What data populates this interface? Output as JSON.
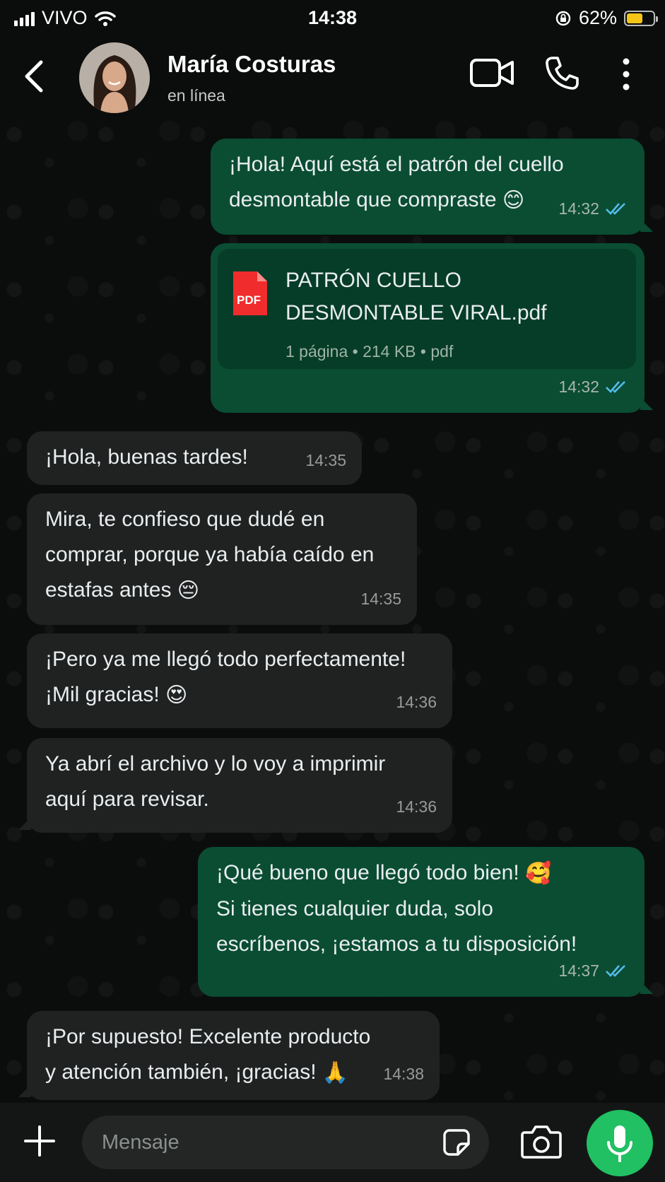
{
  "status_bar": {
    "carrier": "VIVO",
    "time": "14:38",
    "battery": "62%",
    "battery_level": 0.62
  },
  "header": {
    "name": "María Costuras",
    "status": "en línea",
    "icons": [
      "back-arrow-icon",
      "video-call-icon",
      "phone-icon",
      "more-vertical-icon"
    ]
  },
  "messages": [
    {
      "dir": "out",
      "lines": [
        "¡Hola! Aquí está el patrón del cuello",
        "desmontable que compraste"
      ],
      "emoji": "😊",
      "time": "14:32",
      "read": true
    },
    {
      "dir": "out",
      "type": "document",
      "filename_lines": [
        "PATRÓN CUELLO",
        "DESMONTABLE VIRAL.pdf"
      ],
      "file_icon": "PDF",
      "info": "1 página • 214 KB • pdf",
      "time": "14:32",
      "read": true
    },
    {
      "dir": "in",
      "lines": [
        "¡Hola, buenas tardes!"
      ],
      "time": "14:35"
    },
    {
      "dir": "in",
      "lines": [
        "Mira, te confieso que dudé en",
        "comprar, porque ya había caído en",
        "estafas antes"
      ],
      "emoji": "😔",
      "time": "14:35"
    },
    {
      "dir": "in",
      "lines": [
        "¡Pero ya me llegó todo perfectamente!",
        "¡Mil gracias!"
      ],
      "emoji": "😍",
      "time": "14:36"
    },
    {
      "dir": "in",
      "lines": [
        "Ya abrí el archivo y lo voy a imprimir",
        "aquí para revisar."
      ],
      "time": "14:36"
    },
    {
      "dir": "out",
      "lines": [
        "¡Qué bueno que llegó todo bien!",
        "Si tienes cualquier duda, solo",
        "escríbenos, ¡estamos a tu disposición!"
      ],
      "emoji": "🥰",
      "time": "14:37",
      "read": true
    },
    {
      "dir": "in",
      "lines": [
        "¡Por supuesto! Excelente producto",
        "y atención también, ¡gracias!"
      ],
      "emoji": "🙏",
      "time": "14:38"
    }
  ],
  "input": {
    "placeholder": "Mensaje"
  },
  "colors": {
    "outgoing": "#0a4d33",
    "incoming": "#202222",
    "accent": "#21c063",
    "read_ticks": "#53bdeb"
  }
}
